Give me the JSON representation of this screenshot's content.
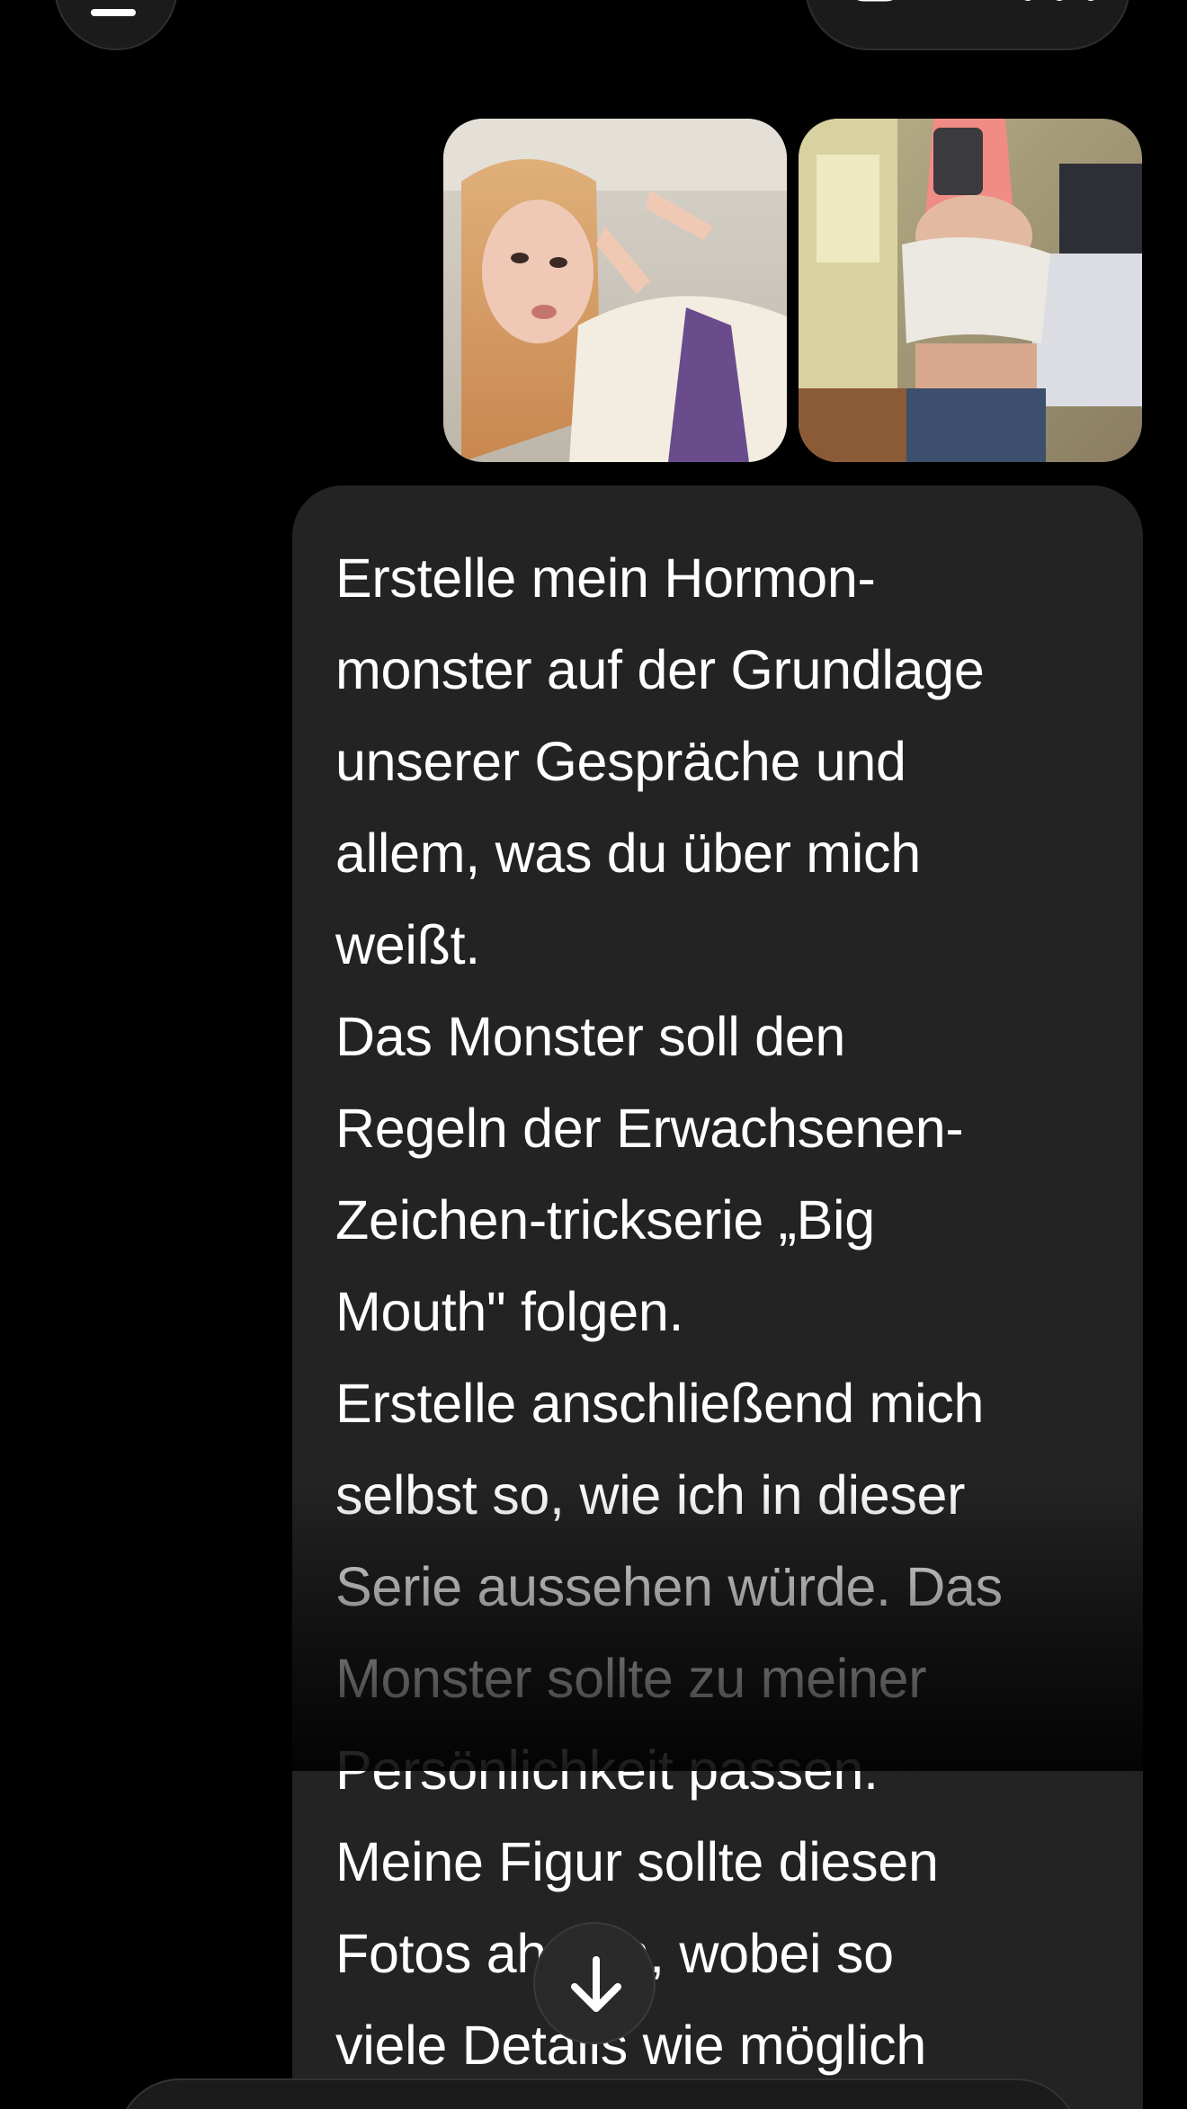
{
  "icons": {
    "menu": "menu-icon",
    "new_chat": "new-chat-icon",
    "more": "more-icon",
    "scroll_down": "arrow-down-icon"
  },
  "colors": {
    "background": "#000000",
    "bubble": "#232323",
    "text": "#ffffff",
    "control": "#1b1b1b"
  },
  "attachments": [
    {
      "kind": "photo"
    },
    {
      "kind": "photo"
    }
  ],
  "message": {
    "lines": [
      "Erstelle mein Hormon-",
      "monster auf der Grundlage",
      "unserer Gespräche und",
      "allem, was du über mich",
      "weißt.",
      "Das Monster soll den",
      "Regeln der Erwachsenen-",
      "Zeichen-trickserie „Big",
      "Mouth\" folgen.",
      "Erstelle anschließend mich",
      "selbst so, wie ich in dieser",
      "Serie aussehen würde. Das",
      "Monster sollte zu meiner",
      "Persönlichkeit passen.",
      "Meine Figur sollte diesen",
      "Fotos ahneln, wobei so",
      "viele Details wie möglich"
    ]
  }
}
